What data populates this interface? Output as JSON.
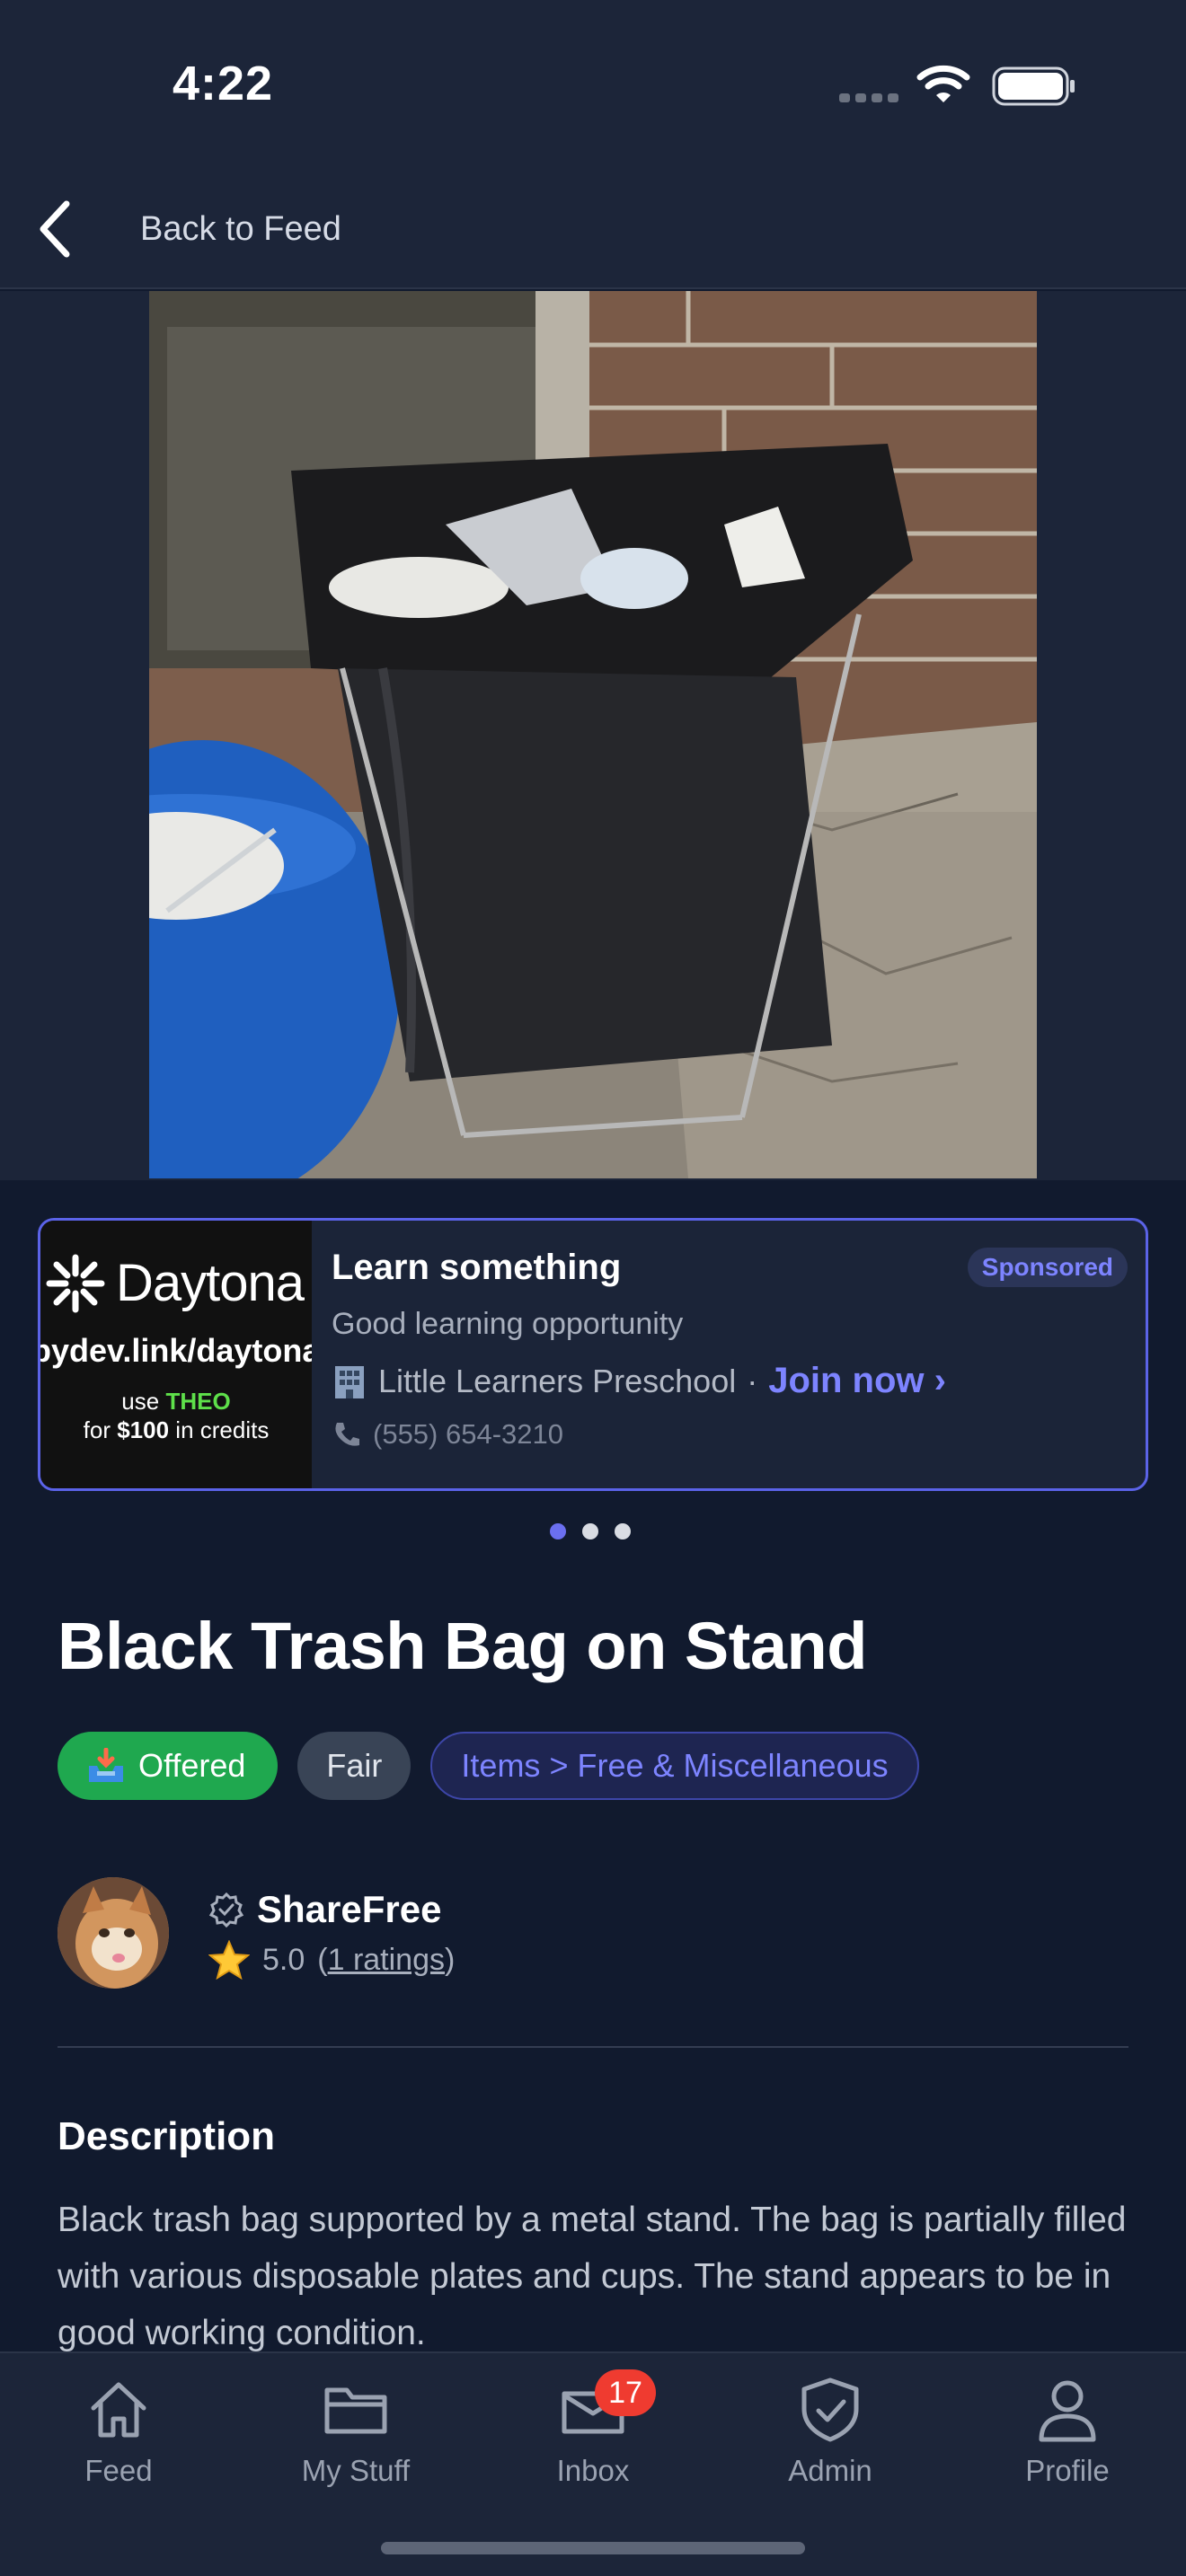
{
  "status_bar": {
    "time": "4:22"
  },
  "nav": {
    "back_label": "Back to Feed"
  },
  "ad": {
    "title": "Learn something",
    "sponsored_label": "Sponsored",
    "subtitle": "Good learning opportunity",
    "org_name": "Little Learners Preschool",
    "separator": "·",
    "cta": "Join now ›",
    "phone": "(555) 654-3210",
    "thumbnail": {
      "brand": "Daytona",
      "link": "bydev.link/daytona",
      "promo_prefix": "use",
      "promo_code": "THEO",
      "promo_for": "for",
      "promo_amount": "$100",
      "promo_suffix": "in credits"
    }
  },
  "carousel": {
    "count": 3,
    "active_index": 0
  },
  "item": {
    "title": "Black Trash Bag on Stand",
    "status_tag": "Offered",
    "condition_tag": "Fair",
    "category_tag": "Items > Free & Miscellaneous"
  },
  "user": {
    "name": "ShareFree",
    "rating": "5.0",
    "ratings_open": "(",
    "ratings_link": "1 ratings",
    "ratings_close": ")"
  },
  "description": {
    "heading": "Description",
    "text": "Black trash bag supported by a metal stand. The bag is partially filled with various disposable plates and cups. The stand appears to be in good working condition."
  },
  "tabbar": {
    "tabs": [
      {
        "label": "Feed",
        "icon": "home-icon"
      },
      {
        "label": "My Stuff",
        "icon": "folder-icon"
      },
      {
        "label": "Inbox",
        "icon": "inbox-icon",
        "badge": "17"
      },
      {
        "label": "Admin",
        "icon": "shield-check-icon"
      },
      {
        "label": "Profile",
        "icon": "person-icon"
      }
    ]
  },
  "colors": {
    "accent": "#6b6ff0",
    "offered": "#1fa84f",
    "badge": "#ef3b30",
    "background": "#111a2e",
    "surface": "#1c2539"
  }
}
